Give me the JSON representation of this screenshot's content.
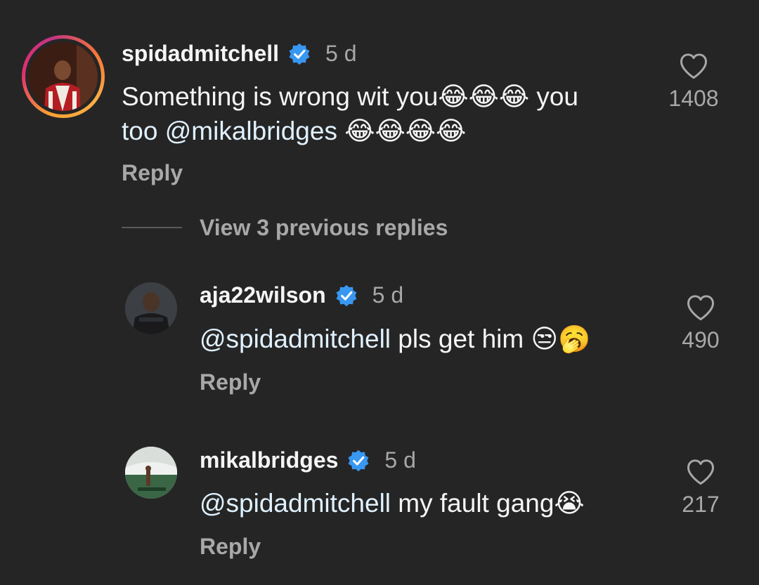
{
  "comments": [
    {
      "username": "spidadmitchell",
      "time": "5 d",
      "text_line1": "Something is wrong wit you😂😂😂 you",
      "text_line2_mention": "too @mikalbridges",
      "text_line2_emojis": "😂😂😂😂",
      "reply": "Reply",
      "likes": "1408"
    }
  ],
  "thread": {
    "view_previous": "View 3 previous replies"
  },
  "replies": [
    {
      "username": "aja22wilson",
      "time": "5 d",
      "mention": "@spidadmitchell",
      "text": " pls get him 😒🥱",
      "reply": "Reply",
      "likes": "490"
    },
    {
      "username": "mikalbridges",
      "time": "5 d",
      "mention": "@spidadmitchell",
      "text": " my fault gang😭",
      "reply": "Reply",
      "likes": "217"
    }
  ],
  "icons": {
    "verified": "verified-badge-icon",
    "heart": "heart-outline-icon"
  },
  "colors": {
    "background": "#252525",
    "verified_blue": "#3897f0",
    "secondary_text": "#a8a8a8"
  }
}
